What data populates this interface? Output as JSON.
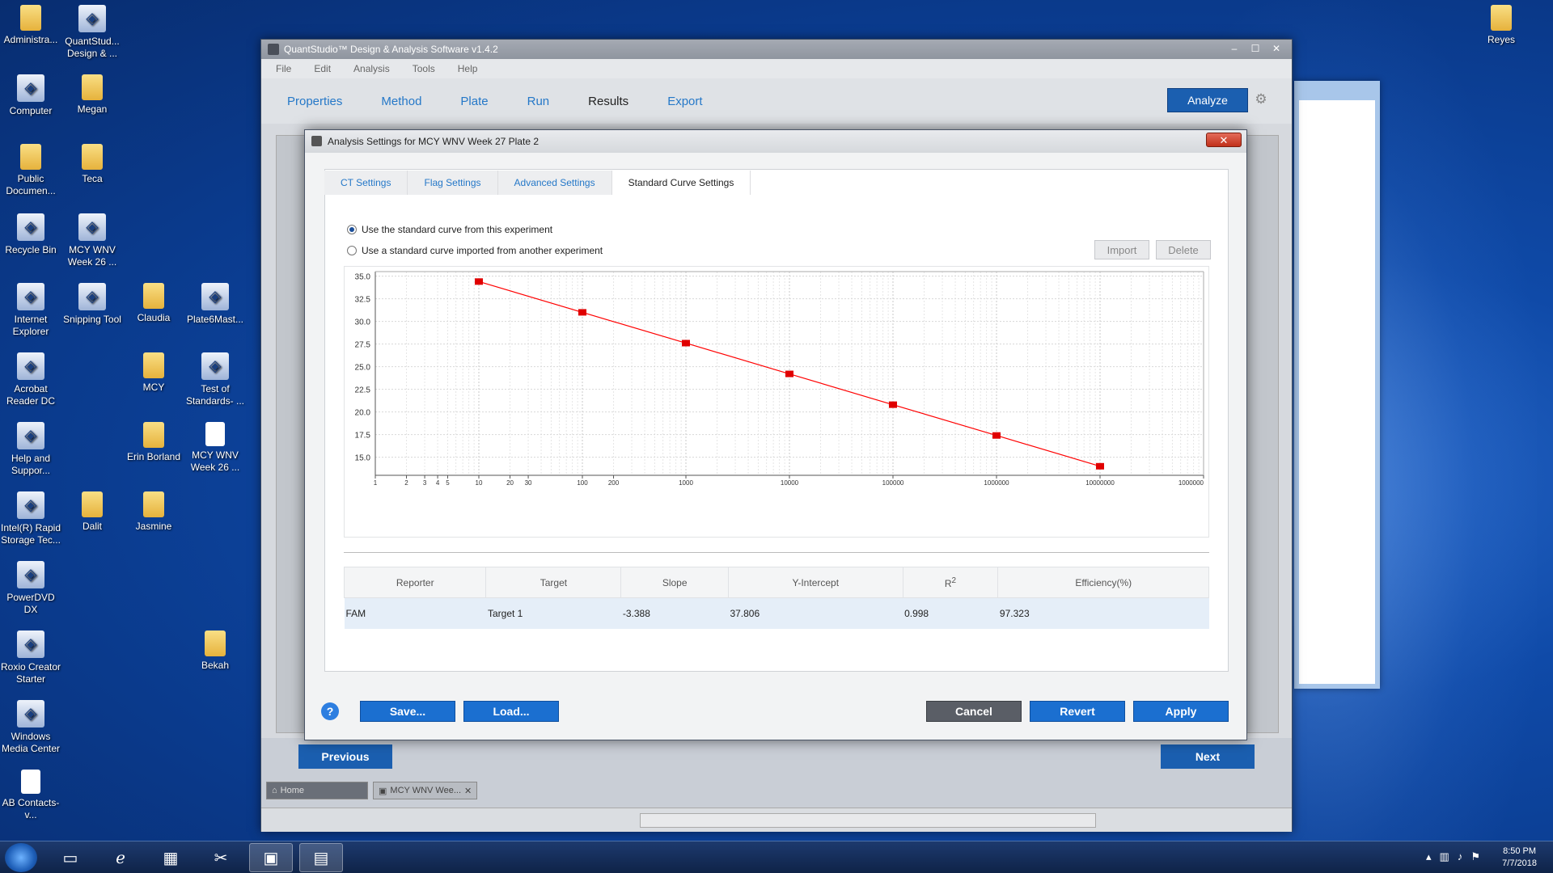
{
  "desktop_icons": [
    {
      "label": "Administra...",
      "kind": "folder"
    },
    {
      "label": "QuantStud... Design & ...",
      "kind": "app"
    },
    {
      "label": "Computer",
      "kind": "app"
    },
    {
      "label": "Megan",
      "kind": "folder"
    },
    {
      "label": "Public Documen...",
      "kind": "folder"
    },
    {
      "label": "Teca",
      "kind": "folder"
    },
    {
      "label": "Recycle Bin",
      "kind": "app"
    },
    {
      "label": "MCY WNV Week 26 ...",
      "kind": "app"
    },
    {
      "label": "Internet Explorer",
      "kind": "app"
    },
    {
      "label": "Snipping Tool",
      "kind": "app"
    },
    {
      "label": "Claudia",
      "kind": "folder"
    },
    {
      "label": "Plate6Mast...",
      "kind": "app"
    },
    {
      "label": "Acrobat Reader DC",
      "kind": "app"
    },
    {
      "label": "MCY",
      "kind": "folder"
    },
    {
      "label": "Test of Standards- ...",
      "kind": "app"
    },
    {
      "label": "Help and Suppor...",
      "kind": "app"
    },
    {
      "label": "Erin Borland",
      "kind": "folder"
    },
    {
      "label": "MCY WNV Week 26 ...",
      "kind": "doc"
    },
    {
      "label": "Intel(R) Rapid Storage Tec...",
      "kind": "app"
    },
    {
      "label": "Dalit",
      "kind": "folder"
    },
    {
      "label": "Jasmine",
      "kind": "folder"
    },
    {
      "label": "PowerDVD DX",
      "kind": "app"
    },
    {
      "label": "Roxio Creator Starter",
      "kind": "app"
    },
    {
      "label": "Bekah",
      "kind": "folder"
    },
    {
      "label": "Windows Media Center",
      "kind": "app"
    },
    {
      "label": "AB Contacts-v...",
      "kind": "doc"
    },
    {
      "label": "Reyes",
      "kind": "folder"
    }
  ],
  "main_window": {
    "title": "QuantStudio™ Design & Analysis Software v1.4.2",
    "menu": [
      "File",
      "Edit",
      "Analysis",
      "Tools",
      "Help"
    ],
    "nav": [
      "Properties",
      "Method",
      "Plate",
      "Run",
      "Results",
      "Export"
    ],
    "active_nav": "Results",
    "analyze_label": "Analyze",
    "previous_label": "Previous",
    "next_label": "Next",
    "tabs": {
      "home": "Home",
      "doc": "MCY WNV Wee..."
    }
  },
  "dialog": {
    "title": "Analysis Settings for MCY WNV Week 27 Plate 2",
    "tabs": [
      "CT Settings",
      "Flag Settings",
      "Advanced Settings",
      "Standard Curve Settings"
    ],
    "active_tab": "Standard Curve Settings",
    "radio_this": "Use the standard curve from this experiment",
    "radio_import": "Use a standard curve imported from another experiment",
    "import_label": "Import",
    "delete_label": "Delete",
    "table": {
      "headers": [
        "Reporter",
        "Target",
        "Slope",
        "Y-Intercept",
        "R2",
        "Efficiency(%)"
      ],
      "rows": [
        [
          "FAM",
          "Target 1",
          "-3.388",
          "37.806",
          "0.998",
          "97.323"
        ]
      ]
    },
    "save_label": "Save...",
    "load_label": "Load...",
    "cancel_label": "Cancel",
    "revert_label": "Revert",
    "apply_label": "Apply"
  },
  "chart_data": {
    "type": "scatter",
    "x_scale": "log",
    "x": [
      10,
      100,
      1000,
      10000,
      100000,
      1000000,
      10000000
    ],
    "y": [
      34.4,
      31.0,
      27.6,
      24.2,
      20.8,
      17.4,
      14.0
    ],
    "xlim": [
      1,
      100000000
    ],
    "ylim": [
      13.0,
      35.5
    ],
    "yticks": [
      "35.0",
      "32.5",
      "30.0",
      "27.5",
      "25.0",
      "22.5",
      "20.0",
      "17.5",
      "15.0"
    ],
    "xtick_labels": [
      "1",
      "2",
      "3",
      "4",
      "5",
      "10",
      "20",
      "30",
      "100",
      "200",
      "1000",
      "10000",
      "100000",
      "1000000",
      "10000000",
      "1000000"
    ],
    "line_color": "#ff0000",
    "marker_color": "#e00000"
  },
  "taskbar": {
    "clock_time": "8:50 PM",
    "clock_date": "7/7/2018"
  }
}
